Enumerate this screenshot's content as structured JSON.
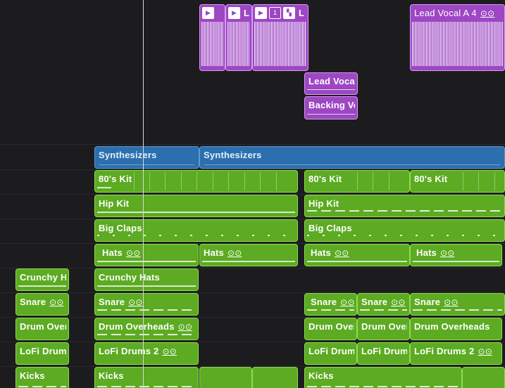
{
  "colors": {
    "green": "#5cab22",
    "purple": "#9d47c4",
    "blue": "#2b6fae",
    "background": "#1c1c1e",
    "playhead": "#d8d8d8"
  },
  "regions": {
    "lead_vocal_a4": "Lead Vocal A 4",
    "purple_btn_1": "1",
    "purple_btn_l": "L",
    "lead_vocal_small": "Lead Voca",
    "backing_vocal_small": "Backing Vo",
    "synth_1": "Synthesizers",
    "synth_2": "Synthesizers",
    "kit_80s_1": "80's Kit",
    "kit_80s_2": "80's Kit",
    "kit_80s_3": "80's Kit",
    "hip_kit_1": "Hip Kit",
    "hip_kit_2": "Hip Kit",
    "big_claps_1": "Big Claps",
    "big_claps_2": "Big Claps",
    "hats": "Hats",
    "crunchy_h": "Crunchy H",
    "crunchy_hats": "Crunchy Hats",
    "snare": "Snare",
    "drum_over": "Drum Over",
    "drum_overheads": "Drum Overheads",
    "drum_ove": "Drum Ovei",
    "lofi_drums_short": "LoFi Drums",
    "lofi_drums_2": "LoFi Drums 2",
    "lofi_drum": "LoFi Drum",
    "kicks": "Kicks"
  },
  "loop_glyph": "⊙⊙"
}
